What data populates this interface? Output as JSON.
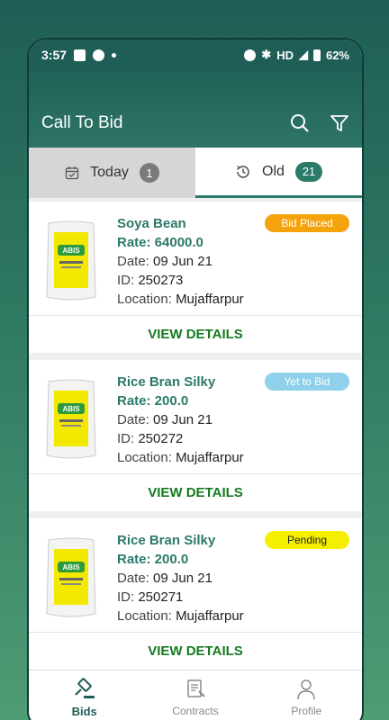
{
  "status": {
    "time": "3:57",
    "battery": "62%",
    "network": "HD"
  },
  "appbar": {
    "title": "Call To Bid",
    "search_icon": "search-icon",
    "filter_icon": "filter-icon"
  },
  "tabs": [
    {
      "label": "Today",
      "count": "1",
      "icon": "calendar-icon"
    },
    {
      "label": "Old",
      "count": "21",
      "icon": "history-icon"
    }
  ],
  "cards": [
    {
      "name": "Soya Bean",
      "rate": "Rate: 64000.0",
      "date_label": "Date:",
      "date": "09 Jun 21",
      "id_label": "ID:",
      "id": "250273",
      "location_label": "Location:",
      "location": "Mujaffarpur",
      "badge": "Bid Placed",
      "details": "VIEW DETAILS"
    },
    {
      "name": "Rice Bran Silky",
      "rate": "Rate: 200.0",
      "date_label": "Date:",
      "date": "09 Jun 21",
      "id_label": "ID:",
      "id": "250272",
      "location_label": "Location:",
      "location": "Mujaffarpur",
      "badge": "Yet to Bid",
      "details": "VIEW DETAILS"
    },
    {
      "name": "Rice Bran Silky",
      "rate": "Rate: 200.0",
      "date_label": "Date:",
      "date": "09 Jun 21",
      "id_label": "ID:",
      "id": "250271",
      "location_label": "Location:",
      "location": "Mujaffarpur",
      "badge": "Pending",
      "details": "VIEW DETAILS"
    }
  ],
  "bag_logo": "ABIS",
  "nav": [
    {
      "label": "Bids",
      "icon": "gavel-icon"
    },
    {
      "label": "Contracts",
      "icon": "contract-icon"
    },
    {
      "label": "Profile",
      "icon": "profile-icon"
    }
  ],
  "colors": {
    "accent": "#2b7a6a",
    "header": "#1f5e56",
    "details_green": "#157a20",
    "badge_placed": "#f5a30c",
    "badge_yet": "#8fd0ea",
    "badge_pending": "#f4f000"
  }
}
